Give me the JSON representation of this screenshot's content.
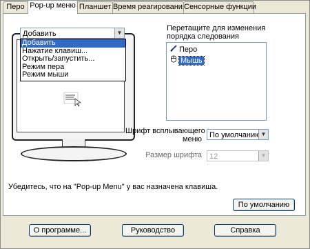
{
  "tabs": [
    "Перо",
    "Pop-up меню",
    "Планшет",
    "Время реагирования",
    "Сенсорные функции"
  ],
  "popup_menu": {
    "action_combo_value": "Добавить",
    "dropdown_items": [
      "Добавить",
      "Нажатие клавиш...",
      "Открыть/запустить...",
      "Режим пера",
      "Режим мыши"
    ],
    "selected_dropdown_index": 0
  },
  "order_panel": {
    "title_line1": "Перетащите для изменения",
    "title_line2": "порядка следования",
    "items": [
      {
        "label": "Перо",
        "icon": "pen-icon"
      },
      {
        "label": "Мышь",
        "icon": "mouse-icon"
      }
    ],
    "selected_index": 1
  },
  "font": {
    "label_line1": "Шрифт всплывающего",
    "label_line2": "меню",
    "value": "По умолчанию",
    "size_label": "Размер шрифта",
    "size_value": "12"
  },
  "notice": "Убедитесь, что на \"Pop-up Menu\" у вас назначена клавиша.",
  "buttons": {
    "default": "По умолчанию",
    "about": "О программе...",
    "manual": "Руководство",
    "help": "Справка"
  },
  "colors": {
    "selection": "#316ac5",
    "background": "#ece9d8"
  }
}
